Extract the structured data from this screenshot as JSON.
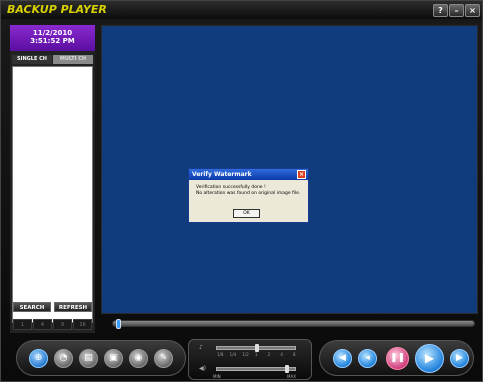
{
  "app": {
    "title": "BACKUP PLAYER",
    "window_buttons": [
      "?",
      "–",
      "×"
    ]
  },
  "sidebar": {
    "date": "11/2/2010",
    "time": "3:51:52 PM",
    "tabs": [
      "SINGLE CH",
      "MULTI CH"
    ],
    "search_label": "SEARCH",
    "refresh_label": "REFRESH",
    "split_buttons": [
      "1",
      "4",
      "9",
      "16"
    ]
  },
  "dialog": {
    "title": "Verify Watermark",
    "line1": "Verification successfully done !",
    "line2": "No alteration was found on original image file.",
    "ok_label": "OK"
  },
  "playback": {
    "seek_position": 0.0
  },
  "toolbar": {
    "tools": [
      "zoom-icon",
      "search-icon",
      "print-icon",
      "save-icon",
      "snapshot-icon",
      "watermark-check-icon"
    ]
  },
  "mixer": {
    "speed_ticks": [
      "1/8",
      "1/4",
      "1/2",
      "1",
      "2",
      "4",
      "8"
    ],
    "volume_min": "MIN",
    "volume_max": "MAX",
    "speed_level": 0.5,
    "volume_level": 0.9
  },
  "transport": {
    "buttons": [
      "rewind-icon",
      "step-back-icon",
      "pause-icon",
      "play-icon",
      "fast-forward-icon"
    ]
  },
  "colors": {
    "title_yellow": "#d8d000",
    "video_blue": "#103c7d",
    "date_purple": "#7a1ec0",
    "accent_blue": "#2a8ae0",
    "pause_pink": "#d04080"
  }
}
